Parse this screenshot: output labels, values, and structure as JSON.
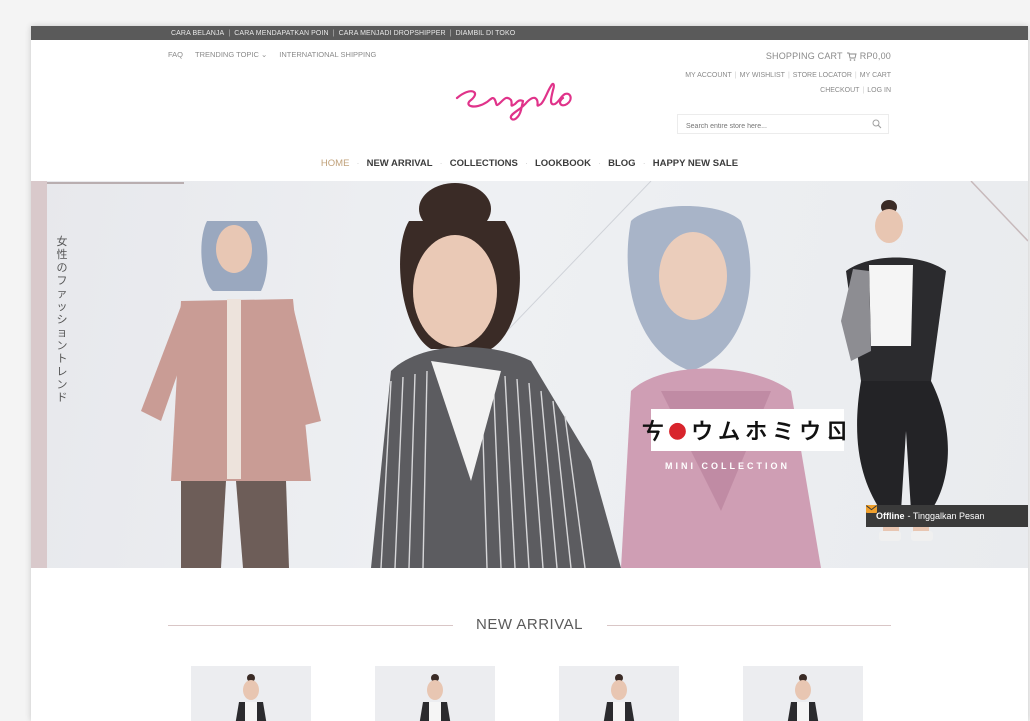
{
  "topbar": {
    "links": [
      "CARA BELANJA",
      "CARA MENDAPATKAN POIN",
      "CARA MENJADI DROPSHIPPER",
      "DIAMBIL DI TOKO"
    ]
  },
  "header": {
    "left_links": [
      "FAQ",
      "TRENDING TOPIC ⌄",
      "INTERNATIONAL SHIPPING"
    ],
    "logo_text": "Encyclo",
    "cart_label": "SHOPPING CART",
    "cart_amount": "RP0,00",
    "account_links_row1": [
      "MY ACCOUNT",
      "MY WISHLIST",
      "STORE LOCATOR",
      "MY CART"
    ],
    "account_links_row2": [
      "CHECKOUT",
      "LOG IN"
    ],
    "search_placeholder": "Search entire store here..."
  },
  "nav": {
    "items": [
      "HOME",
      "NEW ARRIVAL",
      "COLLECTIONS",
      "LOOKBOOK",
      "BLOG",
      "HAPPY NEW SALE"
    ],
    "active_index": 0
  },
  "hero": {
    "vertical_text": "女性のファッショントレンド",
    "brand_chars": [
      "ㄘ",
      "●",
      "ウ",
      "ム",
      "ホ",
      "ミ",
      "ウ",
      "ㄖ"
    ],
    "subtitle": "MINI COLLECTION",
    "icons": [
      "mannequin-figure-1",
      "mannequin-figure-2",
      "mannequin-figure-3",
      "mannequin-figure-4"
    ]
  },
  "chat": {
    "status": "Offline",
    "message": "- Tinggalkan Pesan"
  },
  "section": {
    "title": "NEW ARRIVAL"
  },
  "colors": {
    "accent": "#c0a17a",
    "logo_pink": "#e0338a",
    "topbar": "#5a5a5a",
    "chat_bg": "#3a3a3a"
  }
}
